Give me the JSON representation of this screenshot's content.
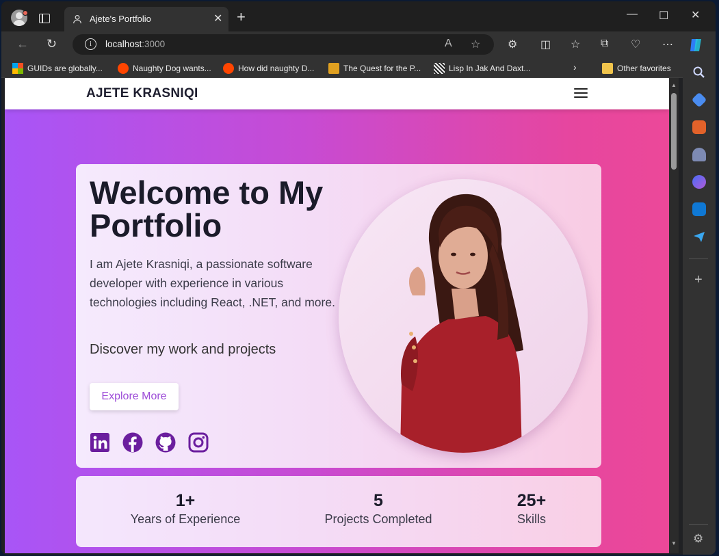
{
  "browser": {
    "tab_title": "Ajete's Portfolio",
    "url_host": "localhost",
    "url_port": ":3000",
    "bookmarks": [
      {
        "label": "GUIDs are globally...",
        "icon": "microsoft-icon"
      },
      {
        "label": "Naughty Dog wants...",
        "icon": "reddit-icon"
      },
      {
        "label": "How did naughty D...",
        "icon": "reddit-icon"
      },
      {
        "label": "The Quest for the P...",
        "icon": "bird-icon"
      },
      {
        "label": "Lisp In Jak And Daxt...",
        "icon": "pattern-icon"
      }
    ],
    "other_favorites": "Other favorites"
  },
  "site": {
    "brand": "AJETE KRASNIQI",
    "hero": {
      "title": "Welcome to My Portfolio",
      "description": "I am Ajete Krasniqi, a passionate software developer with experience in various technologies including React, .NET, and more.",
      "subtitle": "Discover my work and projects",
      "cta": "Explore More"
    },
    "social_icons": [
      "linkedin-icon",
      "facebook-icon",
      "github-icon",
      "instagram-icon"
    ],
    "stats": [
      {
        "value": "1+",
        "label": "Years of Experience"
      },
      {
        "value": "5",
        "label": "Projects Completed"
      },
      {
        "value": "25+",
        "label": "Skills"
      }
    ]
  },
  "colors": {
    "gradient_start": "#a855f7",
    "gradient_end": "#ec4899",
    "accent": "#9d4dd8",
    "icon_purple": "#6b1e9e"
  }
}
